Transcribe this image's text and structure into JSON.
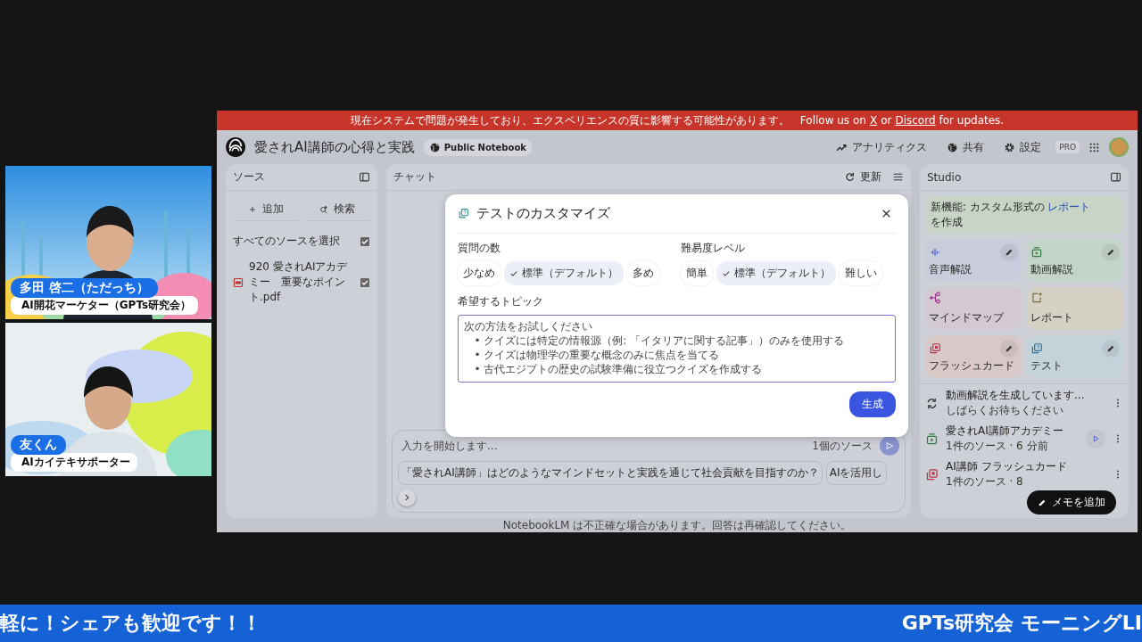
{
  "stream": {
    "cameras": [
      {
        "name": "多田 啓二（ただっち）",
        "role": "AI開花マーケター（GPTs研究会）"
      },
      {
        "name": "友くん",
        "role": "AIカイテキサポーター"
      }
    ],
    "ticker": {
      "left_text": "軽に！シェアも歓迎です！！",
      "right_text": "GPTs研究会 モーニングLI"
    }
  },
  "app": {
    "banner": {
      "message": "現在システムで問題が発生しており、エクスペリエンスの質に影響する可能性があります。",
      "parts": [
        {
          "text": "Follow us on",
          "link": false
        },
        {
          "text": "X",
          "link": true
        },
        {
          "text": "or",
          "link": false
        },
        {
          "text": "Discord",
          "link": true
        },
        {
          "text": "for updates.",
          "link": false
        }
      ]
    },
    "header": {
      "title": "愛されAI講師の心得と実践",
      "badge": "Public Notebook",
      "actions": [
        "アナリティクス",
        "共有",
        "設定"
      ],
      "plan": "PRO"
    },
    "sources": {
      "title": "ソース",
      "buttons": [
        "追加",
        "検索"
      ],
      "select_all": {
        "label": "すべてのソースを選択",
        "checked": true
      },
      "items": [
        {
          "name": "920 愛されAIアカデミー　重要なポイント.pdf",
          "checked": true
        }
      ]
    },
    "chat": {
      "title": "チャット",
      "refresh": "更新",
      "input": {
        "placeholder": "入力を開始します...",
        "source_count": "1個のソース"
      },
      "suggestions": [
        "「愛されAI講師」はどのようなマインドセットと実践を通じて社会貢献を目指すのか？",
        "AIを活用し"
      ]
    },
    "studio": {
      "title": "Studio",
      "notice": [
        {
          "text": "新機能: カスタム形式の",
          "link": false
        },
        {
          "text": "レポート",
          "link": true
        },
        {
          "text": "を作成",
          "link": false
        }
      ],
      "tiles": [
        {
          "label": "音声解説",
          "kind": "audio",
          "color": "#c9ccdb",
          "editable": true
        },
        {
          "label": "動画解説",
          "kind": "video",
          "color": "#c5d4c9",
          "editable": true
        },
        {
          "label": "マインドマップ",
          "kind": "mindmap",
          "color": "#d3c9d1",
          "editable": false
        },
        {
          "label": "レポート",
          "kind": "report",
          "color": "#d5d1c4",
          "editable": false
        },
        {
          "label": "フラッシュカード",
          "kind": "cards",
          "color": "#d8c8c8",
          "editable": true
        },
        {
          "label": "テスト",
          "kind": "quiz",
          "color": "#c4d2d9",
          "editable": true
        }
      ],
      "notes": [
        {
          "title": "動画解説を生成しています...",
          "subtitle": "しばらくお待ちください",
          "kind": "pending",
          "playable": false
        },
        {
          "title": "愛されAI講師アカデミー",
          "subtitle": "1件のソース · 6 分前",
          "kind": "video",
          "playable": true
        },
        {
          "title": "AI講師 フラッシュカード",
          "subtitle": "1件のソース · 8",
          "kind": "cards",
          "playable": false
        }
      ],
      "add_note": "メモを追加"
    },
    "footer": "NotebookLM は不正確な場合があります。回答は再確認してください。"
  },
  "dialog": {
    "title": "テストのカスタマイズ",
    "groups": [
      {
        "label": "質問の数",
        "options": [
          {
            "label": "少なめ",
            "selected": false
          },
          {
            "label": "標準（デフォルト）",
            "selected": true
          },
          {
            "label": "多め",
            "selected": false
          }
        ]
      },
      {
        "label": "難易度レベル",
        "options": [
          {
            "label": "簡単",
            "selected": false
          },
          {
            "label": "標準（デフォルト）",
            "selected": true
          },
          {
            "label": "難しい",
            "selected": false
          }
        ]
      }
    ],
    "topic": {
      "label": "希望するトピック",
      "placeholder": "次の方法をお試しください\n   • クイズには特定の情報源（例: 「イタリアに関する記事」）のみを使用する\n   • クイズは物理学の重要な概念のみに焦点を当てる\n   • 古代エジプトの歴史の試験準備に役立つクイズを作成する"
    },
    "submit": "生成"
  }
}
